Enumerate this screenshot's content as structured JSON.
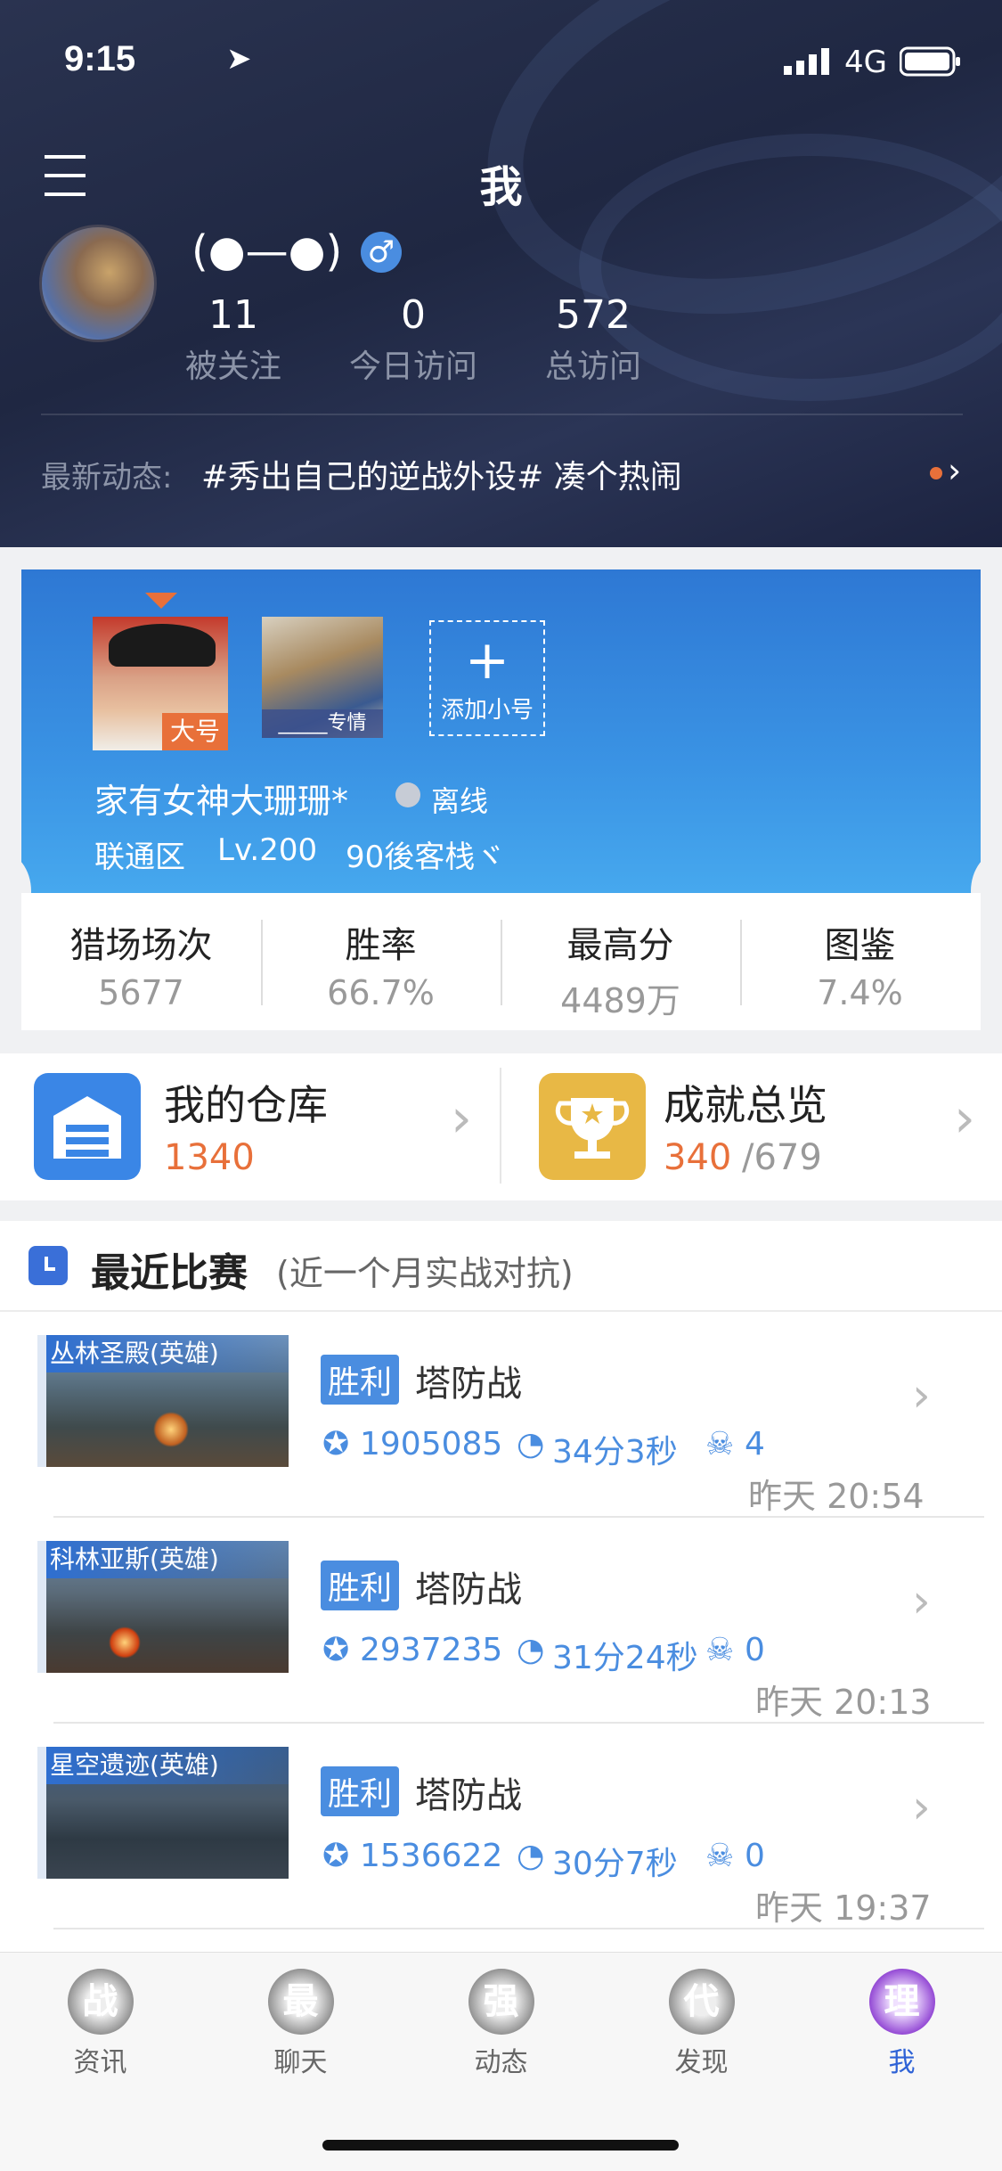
{
  "status_bar": {
    "time": "9:15",
    "network": "4G"
  },
  "header": {
    "title": "我",
    "nickname": "(●—●)",
    "gender_icon": "male-icon",
    "stats": [
      {
        "value": "11",
        "label": "被关注"
      },
      {
        "value": "0",
        "label": "今日访问"
      },
      {
        "value": "572",
        "label": "总访问"
      }
    ],
    "news_label": "最新动态:",
    "news_text": "#秀出自己的逆战外设# 凑个热闹"
  },
  "accounts": {
    "main_tag": "大号",
    "sub_tag": "_____专情",
    "add_label": "添加小号",
    "player_name": "家有女神大珊珊*",
    "status": "离线",
    "server": "联通区",
    "level": "Lv.200",
    "guild": "90後客栈ヾ"
  },
  "stats": [
    {
      "label": "猎场场次",
      "value": "5677"
    },
    {
      "label": "胜率",
      "value": "66.7%"
    },
    {
      "label": "最高分",
      "value": "4489万"
    },
    {
      "label": "图鉴",
      "value": "7.4%"
    }
  ],
  "warehouse": {
    "title": "我的仓库",
    "count": "1340"
  },
  "achievements": {
    "title": "成就总览",
    "done": "340",
    "total": "/679"
  },
  "recent": {
    "title": "最近比赛",
    "subtitle": "(近一个月实战对抗)",
    "matches": [
      {
        "map": "丛林圣殿(英雄)",
        "result": "胜利",
        "mode": "塔防战",
        "score": "1905085",
        "duration": "34分3秒",
        "deaths": "4",
        "time": "昨天 20:54"
      },
      {
        "map": "科林亚斯(英雄)",
        "result": "胜利",
        "mode": "塔防战",
        "score": "2937235",
        "duration": "31分24秒",
        "deaths": "0",
        "time": "昨天 20:13"
      },
      {
        "map": "星空遗迹(英雄)",
        "result": "胜利",
        "mode": "塔防战",
        "score": "1536622",
        "duration": "30分7秒",
        "deaths": "0",
        "time": "昨天 19:37"
      }
    ]
  },
  "tabs": [
    {
      "icon": "战",
      "label": "资讯"
    },
    {
      "icon": "最",
      "label": "聊天"
    },
    {
      "icon": "强",
      "label": "动态"
    },
    {
      "icon": "代",
      "label": "发现"
    },
    {
      "icon": "理",
      "label": "我"
    }
  ],
  "colors": {
    "accent": "#4a8de0",
    "orange": "#e8703a",
    "active_tab": "#2e62d6"
  }
}
